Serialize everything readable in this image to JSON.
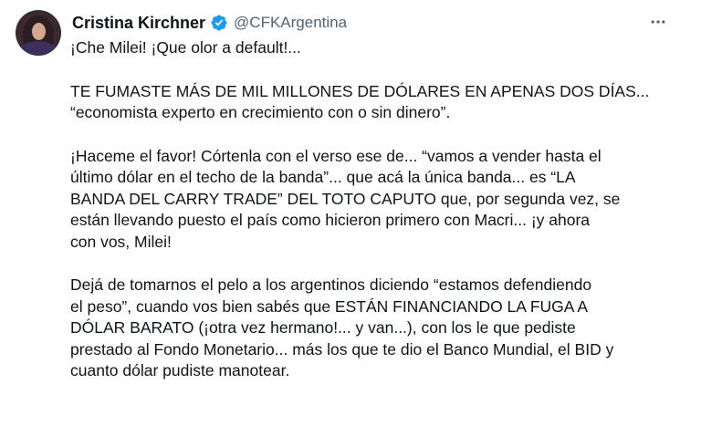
{
  "author": {
    "name": "Cristina Kirchner",
    "handle": "@CFKArgentina",
    "verified_color": "#1d9bf0"
  },
  "icons": {
    "verified": "verified-badge-icon",
    "more": "more-options-icon"
  },
  "tweet": {
    "p1": [
      "¡Che Milei! ¡Que olor a default!..."
    ],
    "p2": [
      "TE FUMASTE MÁS DE MIL MILLONES DE DÓLARES EN APENAS DOS DÍAS...",
      "“economista experto en crecimiento con o sin dinero”."
    ],
    "p3": [
      "¡Haceme el favor! Córtenla con el verso ese de... “vamos a vender hasta el",
      "último dólar en el techo de la banda”... que acá la única banda... es “LA",
      "BANDA DEL CARRY TRADE” DEL TOTO CAPUTO que, por segunda vez, se",
      "están llevando puesto el país como hicieron primero con Macri... ¡y ahora",
      "con vos, Milei!"
    ],
    "p4": [
      "Dejá de tomarnos el pelo a los argentinos diciendo “estamos defendiendo",
      "el peso”, cuando vos bien sabés que ESTÁN FINANCIANDO LA FUGA A",
      "DÓLAR BARATO (¡otra vez hermano!... y van...), con los le que pediste",
      "prestado al Fondo Monetario... más los que te dio el Banco Mundial, el BID y",
      "cuanto dólar pudiste manotear."
    ]
  }
}
